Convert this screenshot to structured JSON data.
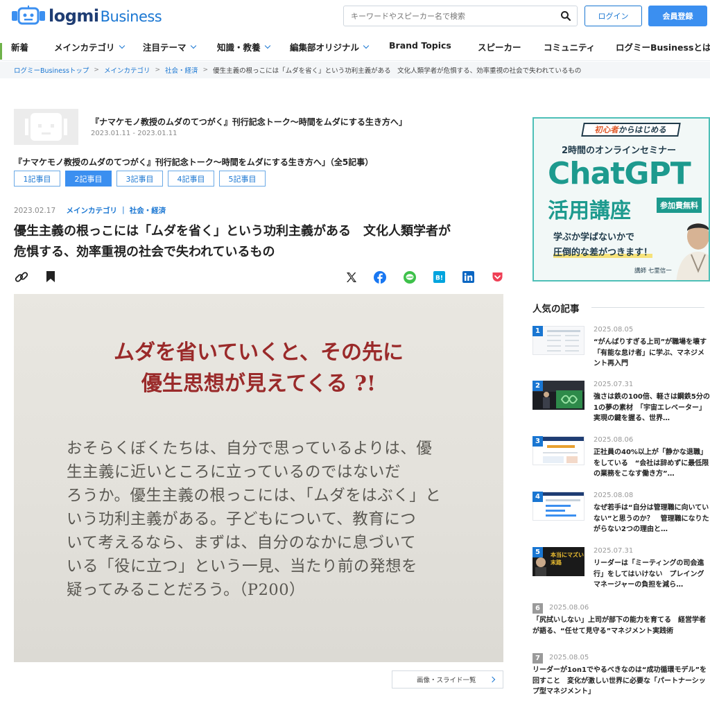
{
  "header": {
    "logo_text": "logmi",
    "logo_sub": "Business",
    "search_placeholder": "キーワードやスピーカー名で検索",
    "login_label": "ログイン",
    "register_label": "会員登録"
  },
  "nav": [
    {
      "label": "新着",
      "dropdown": false
    },
    {
      "label": "メインカテゴリ",
      "dropdown": true
    },
    {
      "label": "注目テーマ",
      "dropdown": true
    },
    {
      "label": "知識・教養",
      "dropdown": true
    },
    {
      "label": "編集部オリジナル",
      "dropdown": true
    },
    {
      "label": "Brand Topics",
      "dropdown": false
    },
    {
      "label": "スピーカー",
      "dropdown": false
    },
    {
      "label": "コミュニティ",
      "dropdown": false
    },
    {
      "label": "ログミーBusinessとは",
      "dropdown": false
    }
  ],
  "breadcrumb": {
    "items": [
      "ログミーBusinessトップ",
      "メインカテゴリ",
      "社会・経済"
    ],
    "current": "優生主義の根っこには「ムダを省く」という功利主義がある　文化人類学者が危惧する、効率重視の社会で失われているもの"
  },
  "series": {
    "title": "『ナマケモノ教授のムダのてつがく』刊行記念トーク〜時間をムダにする生き方へ」",
    "dates": "2023.01.11 - 2023.01.11",
    "full_title": "『ナマケモノ教授のムダのてつがく』刊行記念トーク〜時間をムダにする生き方へ」（全5記事）",
    "parts": [
      "1記事目",
      "2記事目",
      "3記事目",
      "4記事目",
      "5記事目"
    ],
    "active_part": 1
  },
  "article": {
    "date": "2023.02.17",
    "category": "メインカテゴリ ｜ 社会・経済",
    "title_line1": "優生主義の根っこには「ムダを省く」という功利主義がある　文化人類学者が",
    "title_line2": "危惧する、効率重視の社会で失われているもの",
    "hero_headline_1": "ムダを省いていくと、その先に",
    "hero_headline_2": "優生思想が見えてくる ?!",
    "hero_quote": [
      "おそらくぼくたちは、自分で思っているよりは、優",
      "生主義に近いところに立っているのではないだ",
      "ろうか。優生主義の根っこには、「ムダをはぶく」と",
      "いう功利主義がある。子どもについて、教育につ",
      "いて考えるなら、まずは、自分のなかに息づいて",
      "いる「役に立つ」という一見、当たり前の発想を",
      "疑ってみることだろう。（P200）"
    ],
    "slides_label": "画像・スライド一覧"
  },
  "ad": {
    "badge_pre": "初心者",
    "badge_post": "からはじめる",
    "sub": "2時間のオンラインセミナー",
    "main": "ChatGPT",
    "main2": "活用講座",
    "free": "参加費無料",
    "line1": "学ぶか学ばないかで",
    "line2": "圧倒的な差がつきます！",
    "lecturer": "講師 七里信一",
    "accent": "#1d9a8e"
  },
  "popular": {
    "heading": "人気の記事",
    "items": [
      {
        "rank": "1",
        "date": "2025.08.05",
        "title": "“がんばりすぎる上司”が職場を壊す　「有能な怠け者」に学ぶ、マネジメント再入門"
      },
      {
        "rank": "2",
        "date": "2025.07.31",
        "title": "強さは鉄の100倍、軽さは鋼鉄5分の1の夢の素材　「宇宙エレベーター」実現の鍵を握る、世界…"
      },
      {
        "rank": "3",
        "date": "2025.08.06",
        "title": "正社員の40%以上が「静かな退職」をしている　“会社は辞めずに最低限の業務をこなす働き方”…"
      },
      {
        "rank": "4",
        "date": "2025.08.08",
        "title": "なぜ若手は“自分は管理職に向いていない”と思うのか？　管理職になりたがらない2つの理由と…"
      },
      {
        "rank": "5",
        "date": "2025.07.31",
        "title": "リーダーは「ミーティングの司会進行」をしてはいけない　プレイングマネージャーの負担を減ら…"
      },
      {
        "rank": "6",
        "date": "2025.08.06",
        "title": "「尻拭いしない」上司が部下の能力を育てる　経営学者が語る、“任せて見守る”マネジメント実践術"
      },
      {
        "rank": "7",
        "date": "2025.08.05",
        "title": "リーダーが1on1でやるべきなのは“成功循環モデル”を回すこと　変化が激しい世界に必要な「パートナーシップ型マネジメント」"
      }
    ],
    "thumb5_text": "本当にマズい末路"
  }
}
